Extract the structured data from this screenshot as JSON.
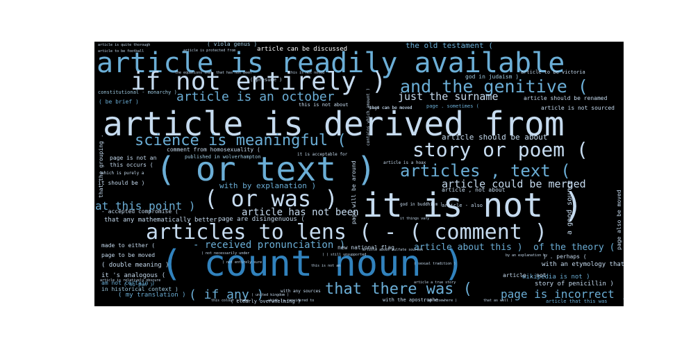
{
  "colors": {
    "background": "#000000",
    "page": "#ffffff",
    "palette": [
      "#6baed6",
      "#c6dbef",
      "#ffffff",
      "#9ecae1",
      "#3182bd",
      "#4292c6",
      "#deebf7"
    ]
  },
  "words": [
    {
      "text": "article is readily available",
      "c": 0
    },
    {
      "text": "if not entirely )",
      "c": 1
    },
    {
      "text": "and the genitive (",
      "c": 0
    },
    {
      "text": "article is derived from",
      "c": 1
    },
    {
      "text": "science is meaningful (",
      "c": 0
    },
    {
      "text": "story or poem (",
      "c": 1
    },
    {
      "text": "( or text )",
      "c": 0
    },
    {
      "text": "articles , text (",
      "c": 0
    },
    {
      "text": "( or was )",
      "c": 1
    },
    {
      "text": "it is not )",
      "c": 1
    },
    {
      "text": "articles to lens ( - ( comment )",
      "c": 1
    },
    {
      "text": "( count noun )",
      "c": 4
    },
    {
      "text": "that there was (",
      "c": 0
    },
    {
      "text": "article is an october",
      "c": 0
    },
    {
      "text": "just the surname",
      "c": 1
    },
    {
      "text": "article could be merged",
      "c": 1
    },
    {
      "text": "article should be about",
      "c": 1
    },
    {
      "text": "article has not been",
      "c": 1
    },
    {
      "text": "- received pronunciation )",
      "c": 0
    },
    {
      "text": "article about this )",
      "c": 0
    },
    {
      "text": "of the theory (",
      "c": 0
    },
    {
      "text": "at this point )",
      "c": 0
    },
    {
      "text": "( if any )",
      "c": 0
    },
    {
      "text": "page is incorrect ,",
      "c": 0
    },
    {
      "text": "the old testament (",
      "c": 0
    },
    {
      "text": "with by explanation )",
      "c": 0
    },
    {
      "text": "article can be discussed",
      "c": 2
    },
    {
      "text": "( viola genus )",
      "c": 3
    },
    {
      "text": "article should be renamed",
      "c": 1
    },
    {
      "text": "article is not sourced",
      "c": 1
    },
    {
      "text": "comment from homosexuality (",
      "c": 1
    },
    {
      "text": "published in wolverhampton",
      "c": 3
    },
    {
      "text": "this occurs (",
      "c": 1
    },
    {
      "text": "it should be )",
      "c": 1
    },
    {
      "text": "- accepted compromise (",
      "c": 1
    },
    {
      "text": "that any mathematically better",
      "c": 1
    },
    {
      "text": "page are disingenuous (",
      "c": 1
    },
    {
      "text": "page is not an",
      "c": 1
    },
    {
      "text": "made to either (",
      "c": 1
    },
    {
      "text": "page to be moved",
      "c": 1
    },
    {
      "text": "( double meaning )",
      "c": 1
    },
    {
      "text": "it 's analogous (",
      "c": 1
    },
    {
      "text": "am not certain )",
      "c": 0
    },
    {
      "text": "( my translation )",
      "c": 0
    },
    {
      "text": "( be brief )",
      "c": 0
    },
    {
      "text": "constitutional - monarchy )",
      "c": 3
    },
    {
      "text": "god in judaism )",
      "c": 3
    },
    {
      "text": "article to be victoria",
      "c": 1
    },
    {
      "text": "this is not about",
      "c": 1
    },
    {
      "text": "page . sometimes (",
      "c": 0
    },
    {
      "text": "new national flag",
      "c": 1
    },
    {
      "text": "with an etymology that",
      "c": 1
    },
    {
      "text": "wikipedia is not )",
      "c": 0
    },
    {
      "text": "story of penicillin )",
      "c": 1
    },
    {
      "text": ") . perhaps (",
      "c": 1
    },
    {
      "text": "article , not",
      "c": 1
    },
    {
      "text": "( clearly overwhelming )",
      "c": 1
    },
    {
      "text": "( no pun )",
      "c": 0
    },
    {
      "text": "with the apostrophe",
      "c": 1
    },
    {
      "text": "article that this was",
      "c": 0
    },
    {
      "text": "with any sources",
      "c": 1
    },
    {
      "text": "it is acceptable for",
      "c": 1
    },
    {
      "text": "article , not about",
      "c": 1
    },
    {
      "text": "page can be moved",
      "c": 1
    },
    {
      "text": "in historical context )",
      "c": 3
    },
    {
      "text": "article - also",
      "c": 1
    },
    {
      "text": "a good source",
      "c": 1
    },
    {
      "text": "that the grouping .",
      "c": 1
    },
    {
      "text": "page will be around",
      "c": 1
    },
    {
      "text": "page also be moved",
      "c": 1
    },
    {
      "text": "( presume )",
      "c": 1
    },
    {
      "text": "article is protected from",
      "c": 1
    },
    {
      "text": "article is quite thorough",
      "c": 1
    },
    {
      "text": "article to be football",
      "c": 1
    },
    {
      "text": "that has not been",
      "c": 1
    },
    {
      "text": "the equations that",
      "c": 1
    },
    {
      "text": "this is not noted",
      "c": 1
    },
    {
      "text": "contains which amount )",
      "c": 1
    },
    {
      "text": "that can be moved",
      "c": 1
    },
    {
      "text": "which is purely a",
      "c": 1
    },
    {
      "text": "article is a hoax",
      "c": 1
    },
    {
      "text": "god in buddhism )",
      "c": 1
    },
    {
      "text": "it things vary",
      "c": 1
    },
    {
      "text": "article a true story",
      "c": 1
    },
    {
      "text": "article is relatively obscure",
      "c": 1
    },
    {
      "text": "this colour scheme",
      "c": 1
    },
    {
      "text": "which is considered to",
      "c": 1
    },
    {
      "text": "( united kingdom )",
      "c": 1
    },
    {
      "text": "( as elsewhere )",
      "c": 1
    },
    {
      "text": "that as well )",
      "c": 1
    },
    {
      "text": "by an explanation by",
      "c": 1
    },
    {
      "text": "( sexual tradition )",
      "c": 1
    },
    {
      "text": "article about sulfate sources",
      "c": 1
    },
    {
      "text": "( ( still unsupported",
      "c": 1
    },
    {
      "text": "( not necessarily under",
      "c": 1
    },
    {
      "text": "this is not an",
      "c": 1
    },
    {
      "text": "( not entirely sure",
      "c": 1
    }
  ]
}
